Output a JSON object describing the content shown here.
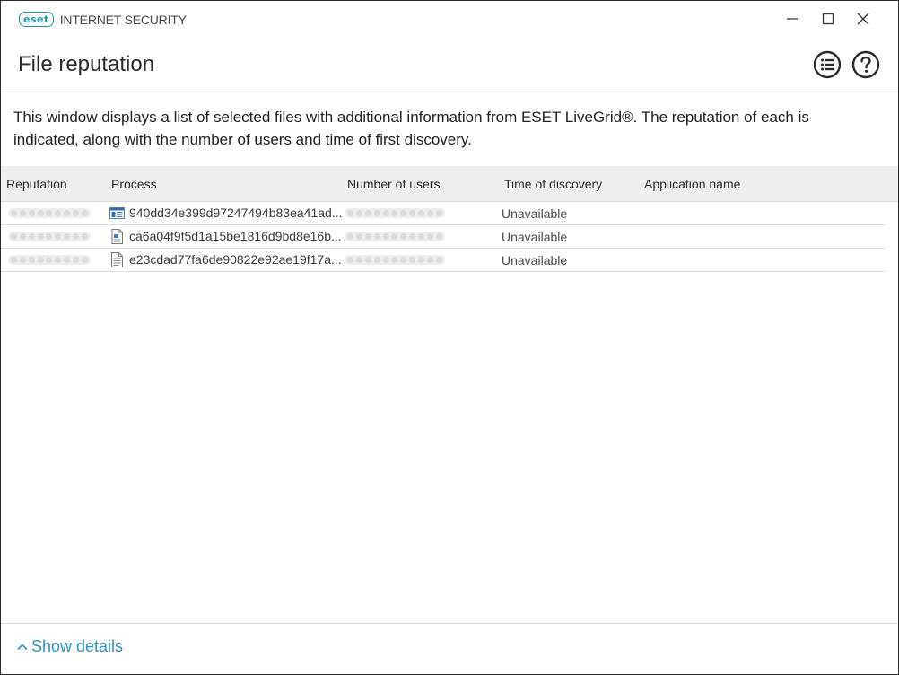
{
  "app": {
    "logo_text": "eset",
    "title": "INTERNET SECURITY"
  },
  "window_controls": [
    "minimize-icon",
    "maximize-icon",
    "close-icon"
  ],
  "header": {
    "title": "File reputation",
    "icons": [
      "list-menu-icon",
      "help-icon"
    ]
  },
  "description": "This window displays a list of selected files with additional information from ESET LiveGrid®. The reputation of each is indicated, along with the number of users and time of first discovery.",
  "table": {
    "columns": [
      "Reputation",
      "Process",
      "Number of users",
      "Time of discovery",
      "Application name"
    ],
    "rows": [
      {
        "icon": "application-window-icon",
        "process": "940dd34e399d97247494b83ea41ad...",
        "discovery": "Unavailable",
        "app_name": ""
      },
      {
        "icon": "script-file-icon",
        "process": "ca6a04f9f5d1a15be1816d9bd8e16b...",
        "discovery": "Unavailable",
        "app_name": ""
      },
      {
        "icon": "text-document-icon",
        "process": "e23cdad77fa6de90822e92ae19f17a...",
        "discovery": "Unavailable",
        "app_name": ""
      }
    ]
  },
  "footer": {
    "details_label": "Show details"
  },
  "colors": {
    "brand": "#1a9bb0",
    "link": "#2f8fc7",
    "header_bg": "#efefef"
  }
}
